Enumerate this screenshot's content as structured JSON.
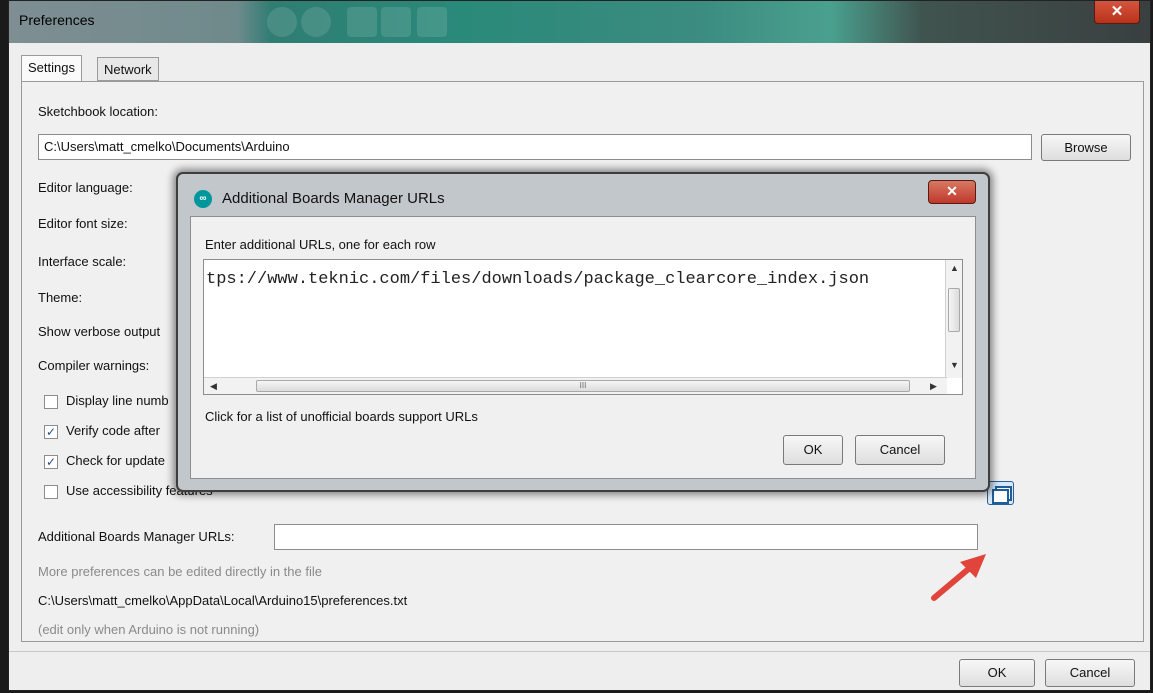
{
  "window": {
    "title": "Preferences",
    "close_glyph": "✕"
  },
  "tabs": [
    {
      "label": "Settings"
    },
    {
      "label": "Network"
    }
  ],
  "settings": {
    "sketchbook_label": "Sketchbook location:",
    "sketchbook_value": "C:\\Users\\matt_cmelko\\Documents\\Arduino",
    "browse_label": "Browse",
    "editor_language_label": "Editor language:",
    "editor_font_size_label": "Editor font size:",
    "interface_scale_label": "Interface scale:",
    "theme_label": "Theme:",
    "verbose_label": "Show verbose output",
    "compiler_warnings_label": "Compiler warnings:",
    "checkboxes": [
      {
        "label": "Display line numb",
        "checked": false
      },
      {
        "label": "Verify code after",
        "checked": true
      },
      {
        "label": "Check for update",
        "checked": true
      },
      {
        "label": "Use accessibility features",
        "checked": false
      }
    ],
    "boards_urls_label": "Additional Boards Manager URLs:",
    "boards_urls_value": "",
    "more_prefs_note": "More preferences can be edited directly in the file",
    "prefs_path": "C:\\Users\\matt_cmelko\\AppData\\Local\\Arduino15\\preferences.txt",
    "edit_note": "(edit only when Arduino is not running)"
  },
  "footer": {
    "ok_label": "OK",
    "cancel_label": "Cancel"
  },
  "dialog": {
    "title": "Additional Boards Manager URLs",
    "logo_glyph": "∞",
    "close_glyph": "✕",
    "instruction": "Enter additional URLs, one for each row",
    "url_text": "tps://www.teknic.com/files/downloads/package_clearcore_index.json",
    "unofficial_link": "Click for a list of unofficial boards support URLs",
    "ok_label": "OK",
    "cancel_label": "Cancel",
    "hthumb_grip": "III"
  },
  "colors": {
    "accent_teal": "#00979c",
    "close_red": "#c0382a",
    "annotation_arrow": "#e0443a"
  }
}
